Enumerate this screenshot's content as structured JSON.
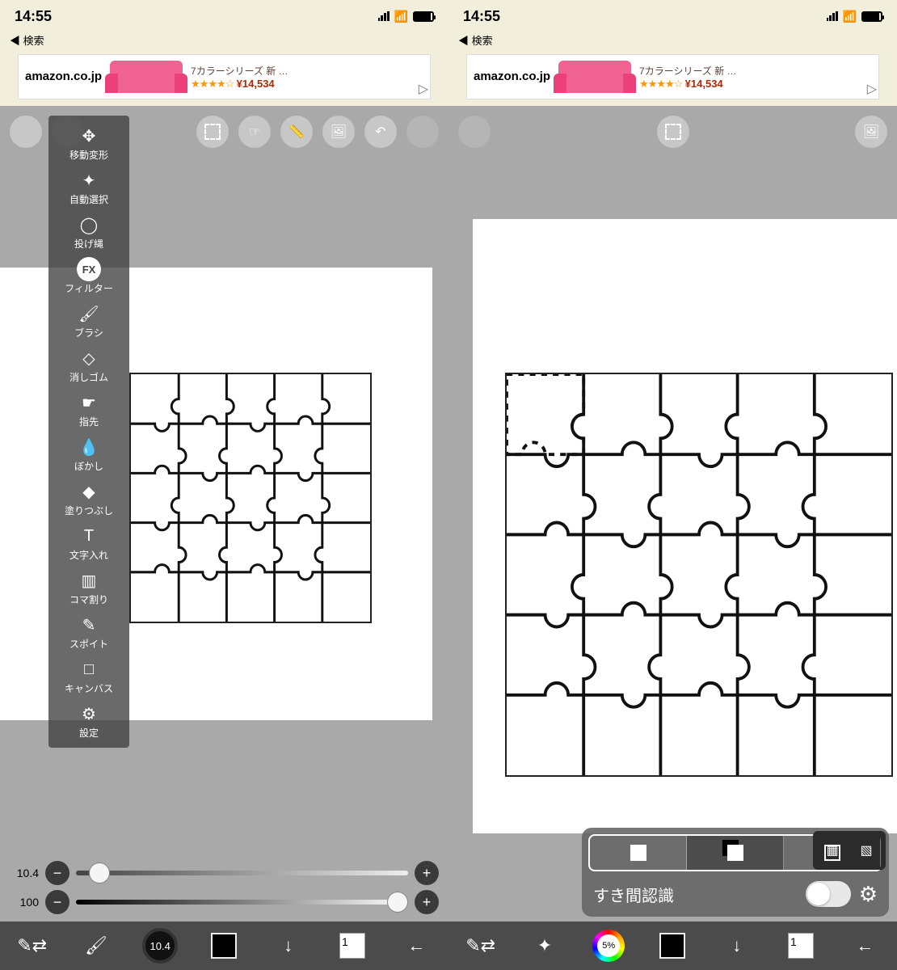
{
  "status": {
    "time": "14:55",
    "back_label": "◀ 検索"
  },
  "ad": {
    "brand_main": "amazon",
    "brand_suffix": ".co.jp",
    "title": "7カラーシリーズ 新 …",
    "stars": "★★★★☆",
    "price": "¥14,534",
    "corner": "▷"
  },
  "left": {
    "tools": [
      {
        "label": "移動変形",
        "icon": "✥"
      },
      {
        "label": "自動選択",
        "icon": "✦"
      },
      {
        "label": "投げ縄",
        "icon": "◯"
      },
      {
        "label": "フィルター",
        "icon": "FX",
        "fx": true
      },
      {
        "label": "ブラシ",
        "icon": "／"
      },
      {
        "label": "消しゴム",
        "icon": "◆"
      },
      {
        "label": "指先",
        "icon": "☛"
      },
      {
        "label": "ぼかし",
        "icon": "●"
      },
      {
        "label": "塗りつぶし",
        "icon": "◆"
      },
      {
        "label": "文字入れ",
        "icon": "T"
      },
      {
        "label": "コマ割り",
        "icon": "▥"
      },
      {
        "label": "スポイト",
        "icon": "✎"
      },
      {
        "label": "キャンバス",
        "icon": "□"
      },
      {
        "label": "設定",
        "icon": "⚙"
      }
    ],
    "slider1_label": "10.4",
    "slider2_label": "100",
    "bottom_size": "10.4",
    "layers": "1"
  },
  "right": {
    "sel_label": "すき間認識",
    "color_pct": "5%",
    "layers": "1"
  }
}
